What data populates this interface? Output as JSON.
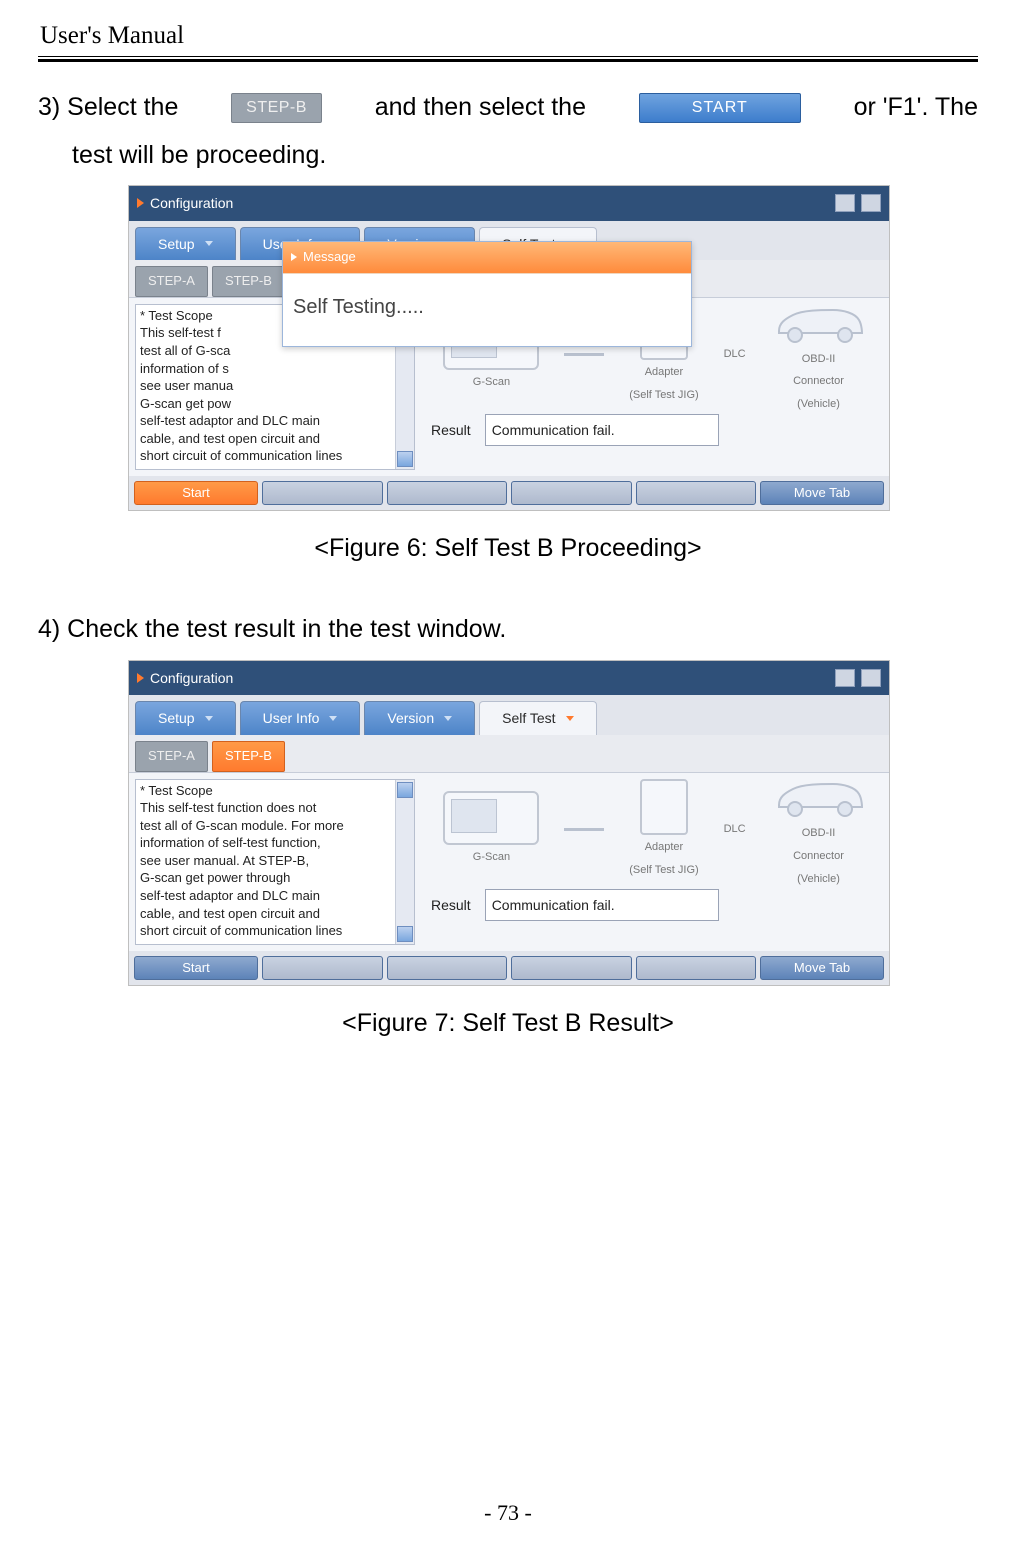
{
  "header_title": "User's Manual",
  "step3": {
    "pre": "3) Select  the",
    "chip": "STEP-B",
    "mid": "and  then  select  the",
    "chip2": "START",
    "post": "or  'F1'.  The",
    "line2": "test will be proceeding."
  },
  "shot": {
    "config": "Configuration",
    "tabs": [
      "Setup",
      "User Info",
      "Version",
      "Self Test"
    ],
    "subtabs": [
      "STEP-A",
      "STEP-B"
    ],
    "scope_1_text": "* Test Scope\n  This self-test f\ntest all of G-sca\ninformation of s\nsee user manua\nG-scan get pow\nself-test adaptor and DLC main\ncable, and test open circuit and\nshort circuit of communication lines",
    "scope_2_text": "* Test Scope\n  This self-test function does not\ntest all of G-scan module. For more\ninformation of self-test function,\nsee user manual. At STEP-B,\nG-scan get power through\nself-test adaptor and DLC main\ncable, and test open circuit and\nshort circuit of communication lines",
    "dev": {
      "gscan": "G-Scan",
      "adapter1": "Adapter",
      "adapter2": "(Self Test JIG)",
      "obd1": "OBD-II",
      "obd2": "Connector",
      "obd3": "(Vehicle)",
      "dlc": "DLC"
    },
    "result_label": "Result",
    "result_value": "Communication fail.",
    "msg_title": "Message",
    "msg_body": "Self Testing.....",
    "start": "Start",
    "move": "Move Tab"
  },
  "caption1": "<Figure 6: Self Test B Proceeding>",
  "step4": "4) Check the test result in the test window.",
  "caption2": "<Figure 7: Self Test B Result>",
  "page_no": "- 73 -"
}
